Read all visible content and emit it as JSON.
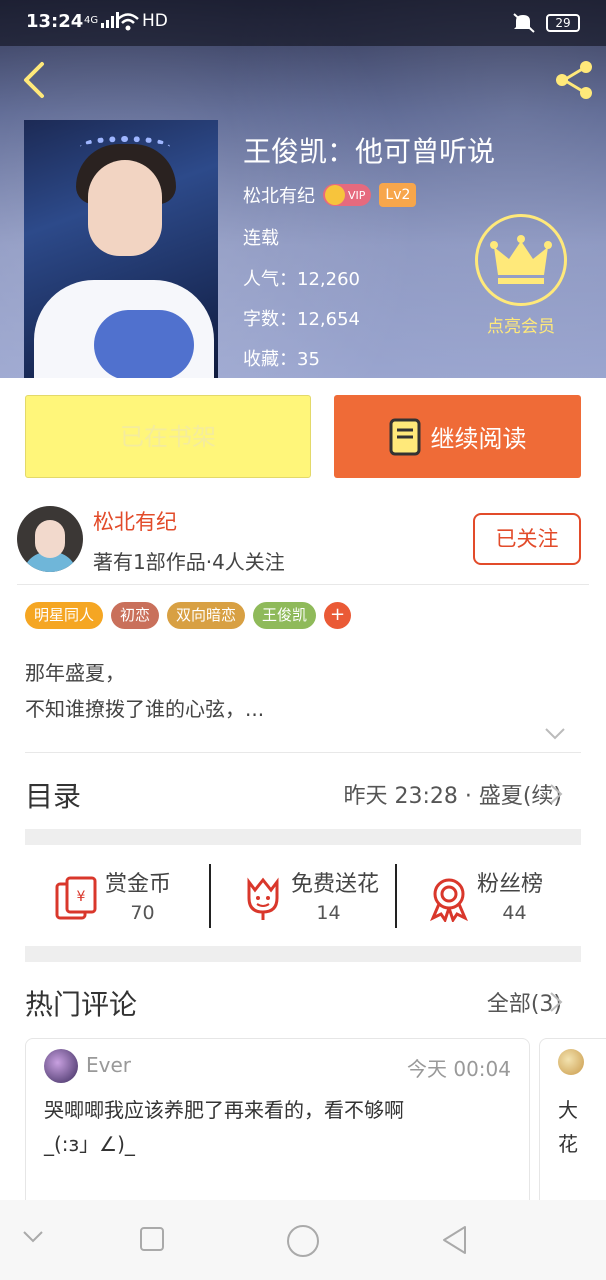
{
  "status_bar": {
    "time": "13:24",
    "network": "4G",
    "hd": "HD",
    "battery": "29"
  },
  "book": {
    "title": "王俊凯：他可曾听说",
    "author": "松北有纪",
    "vip_label": "VIP",
    "level": "Lv2",
    "status": "连载",
    "popularity": "人气：12,260",
    "word_count": "字数：12,654",
    "favorites": "收藏：35"
  },
  "vip_promo": {
    "label": "点亮会员"
  },
  "actions": {
    "shelf_label": "已在书架",
    "read_label": "继续阅读"
  },
  "author_card": {
    "name": "松北有纪",
    "subtitle": "著有1部作品·4人关注",
    "follow_label": "已关注"
  },
  "tags": [
    {
      "label": "明星同人",
      "color": "#f5a623"
    },
    {
      "label": "初恋",
      "color": "#c9705b"
    },
    {
      "label": "双向暗恋",
      "color": "#d8a043"
    },
    {
      "label": "王俊凯",
      "color": "#8fba5a"
    }
  ],
  "tag_add_label": "+",
  "synopsis": {
    "line1": "那年盛夏，",
    "line2": "不知谁撩拨了谁的心弦，..."
  },
  "toc": {
    "title": "目录",
    "latest": "昨天 23:28 · 盛夏(续)"
  },
  "stats": [
    {
      "name": "赏金币",
      "value": "70",
      "icon": "red-envelope-icon"
    },
    {
      "name": "免费送花",
      "value": "14",
      "icon": "flower-icon"
    },
    {
      "name": "粉丝榜",
      "value": "44",
      "icon": "medal-icon"
    }
  ],
  "comments": {
    "title": "热门评论",
    "all_label": "全部(3)",
    "items": [
      {
        "user": "Ever",
        "time": "今天 00:04",
        "text_line1": "哭唧唧我应该养肥了再来看的，看不够啊",
        "text_line2": "_(:з」∠)_"
      },
      {
        "text_line1": "大",
        "text_line2": "花"
      }
    ]
  },
  "colors": {
    "accent": "#ef6b37",
    "brand_red": "#e24b2a",
    "shelf_yellow": "#fff67a",
    "vip_yellow": "#ffe97a"
  }
}
